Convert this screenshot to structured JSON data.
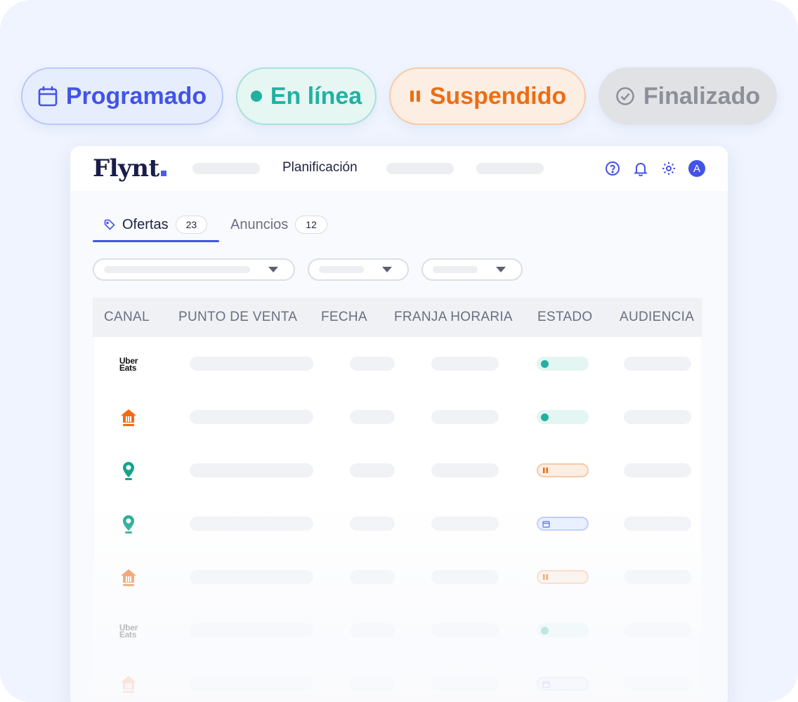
{
  "status_chips": {
    "scheduled": "Programado",
    "live": "En línea",
    "suspended": "Suspendido",
    "finished": "Finalizado"
  },
  "app": {
    "logo": "Flynt",
    "nav_active": "Planificación"
  },
  "tabs": [
    {
      "label": "Ofertas",
      "count": "23",
      "active": true
    },
    {
      "label": "Anuncios",
      "count": "12",
      "active": false
    }
  ],
  "table": {
    "headers": [
      "CANAL",
      "PUNTO DE VENTA",
      "FECHA",
      "FRANJA HORARIA",
      "ESTADO",
      "AUDIENCIA"
    ],
    "rows": [
      {
        "channel": "uber-eats",
        "status": "live"
      },
      {
        "channel": "just-eat",
        "status": "live"
      },
      {
        "channel": "location-pin",
        "status": "suspended"
      },
      {
        "channel": "location-pin",
        "status": "scheduled"
      },
      {
        "channel": "just-eat",
        "status": "suspended"
      },
      {
        "channel": "uber-eats",
        "status": "live"
      },
      {
        "channel": "just-eat",
        "status": "scheduled"
      }
    ]
  },
  "uber_eats_logo": {
    "line1": "Uber",
    "line2": "Eats"
  },
  "colors": {
    "scheduled": "#4353e8",
    "live": "#22b0a0",
    "suspended": "#ed6d13",
    "finished": "#8d9099",
    "accent": "#4353e8"
  }
}
